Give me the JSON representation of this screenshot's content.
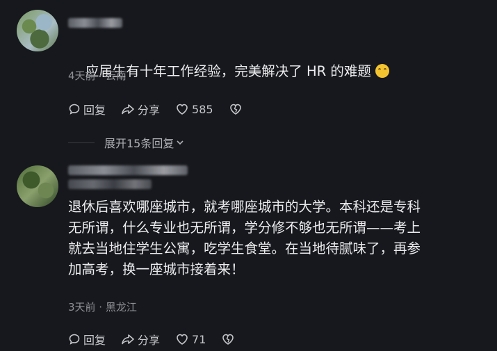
{
  "comments": [
    {
      "text": "应届生有十年工作经验，完美解决了 HR 的难题",
      "emoji": "laughing-crying-emoji",
      "meta": "4天前 · 云南",
      "reply_label": "回复",
      "share_label": "分享",
      "like_count": "585"
    },
    {
      "text": "退休后喜欢哪座城市，就考哪座城市的大学。本科还是专科\n无所谓，什么专业也无所谓，学分修不够也无所谓——考上\n就去当地住学生公寓，吃学生食堂。在当地待腻味了，再参\n加高考，换一座城市接着来！",
      "meta": "3天前 · 黑龙江",
      "reply_label": "回复",
      "share_label": "分享",
      "like_count": "71"
    }
  ],
  "expand_replies": {
    "label": "展开15条回复"
  },
  "colors": {
    "background": "#16181d",
    "text": "#ececee",
    "meta": "#8e9096"
  }
}
